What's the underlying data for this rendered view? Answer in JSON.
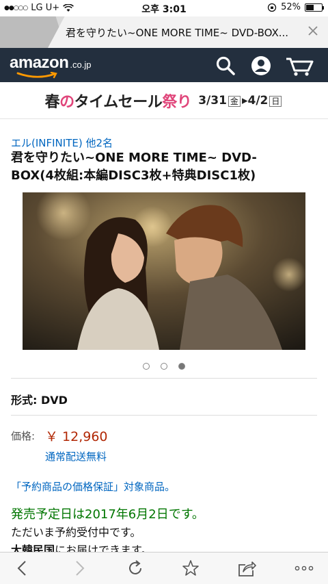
{
  "status_bar": {
    "carrier": "LG U+",
    "time": "오후 3:01",
    "battery": "52%",
    "battery_level": 0.52
  },
  "browser_tab": {
    "title": "君を守りたい~ONE MORE TIME~ DVD-BOX..."
  },
  "header": {
    "logo_word": "amazon",
    "logo_tld": ".co.jp",
    "icons": [
      "search-icon",
      "account-icon",
      "cart-icon"
    ]
  },
  "banner": {
    "part1": "春",
    "part2": "の",
    "part3": "タイムセール",
    "part4": "祭り",
    "date_start": "3/31",
    "day_start": "金",
    "date_end": "4/2",
    "day_end": "日"
  },
  "product": {
    "author": "エル(INFINITE) 他2名",
    "title_line1": "君を守りたい~ONE MORE TIME~ DVD-",
    "title_line2": "BOX(4枚組:本編DISC3枚+特典DISC1枚)",
    "carousel_total": 3,
    "carousel_active": 3,
    "format": "形式: DVD",
    "price_label": "価格:",
    "price": "￥ 12,960",
    "shipping": "通常配送無料",
    "guarantee": "「予約商品の価格保証」対象商品。",
    "release": "発売予定日は2017年6月2日です。",
    "preorder": "ただいま予約受付中です。",
    "delivery_bold": "大韓民国",
    "delivery_rest": "にお届けできます。"
  },
  "toolbar": {
    "icons": [
      "back-icon",
      "forward-icon",
      "reload-icon",
      "bookmark-icon",
      "share-icon",
      "more-icon"
    ]
  },
  "colors": {
    "amazon_header": "#232f3e",
    "link": "#0066c0",
    "price": "#b12704",
    "release": "#007600",
    "banner_accent": "#e0457a"
  }
}
